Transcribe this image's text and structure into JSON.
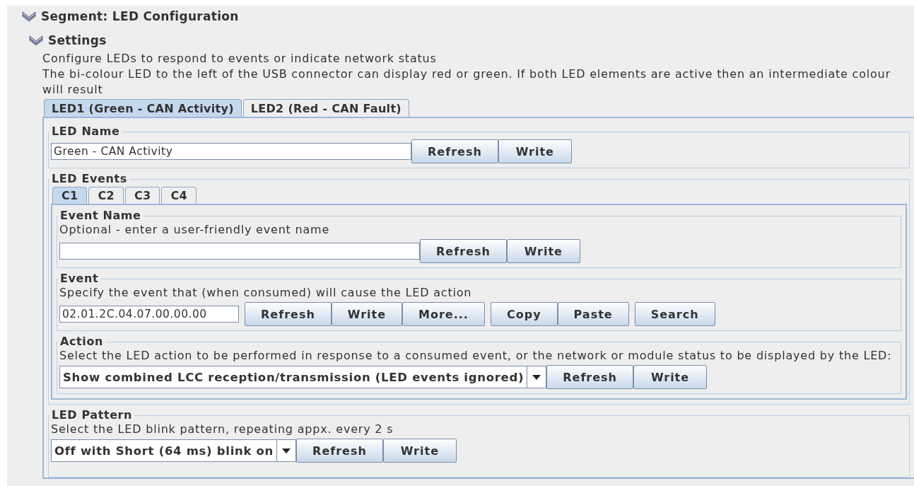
{
  "segment": {
    "title": "Segment: LED Configuration",
    "expanded": true
  },
  "settings": {
    "title": "Settings",
    "expanded": true,
    "descriptions": [
      "Configure LEDs to respond to events or indicate network status",
      "The bi-colour LED to the left of the USB connector can display red or green. If both LED elements are active then an intermediate colour will result"
    ]
  },
  "led_tabs": [
    {
      "label": "LED1 (Green - CAN Activity)",
      "selected": true
    },
    {
      "label": "LED2 (Red - CAN Fault)",
      "selected": false
    }
  ],
  "led_name": {
    "title": "LED Name",
    "value": "Green - CAN Activity",
    "buttons": [
      "Refresh",
      "Write"
    ]
  },
  "led_events": {
    "title": "LED Events",
    "tabs": [
      {
        "label": "C1",
        "selected": true
      },
      {
        "label": "C2",
        "selected": false
      },
      {
        "label": "C3",
        "selected": false
      },
      {
        "label": "C4",
        "selected": false
      }
    ],
    "event_name": {
      "title": "Event Name",
      "description": "Optional - enter a user-friendly event name",
      "buttons": [
        "Refresh",
        "Write"
      ]
    },
    "event": {
      "title": "Event",
      "description": "Specify the event that (when consumed) will cause the LED action",
      "value": "02.01.2C.04.07.00.00.00",
      "button_groups": [
        [
          "Refresh",
          "Write",
          "More..."
        ],
        [
          "Copy",
          "Paste"
        ],
        [
          "Search"
        ]
      ]
    },
    "action": {
      "title": "Action",
      "description": "Select the LED action to be performed in response to a consumed event, or the network or module status to be displayed by the LED:",
      "value": "Show combined LCC reception/transmission (LED events ignored)",
      "buttons": [
        "Refresh",
        "Write"
      ]
    }
  },
  "led_pattern": {
    "title": "LED Pattern",
    "description": "Select the LED blink pattern, repeating appx. every 2 s",
    "value": "Off with Short (64 ms) blink on",
    "buttons": [
      "Refresh",
      "Write"
    ]
  }
}
